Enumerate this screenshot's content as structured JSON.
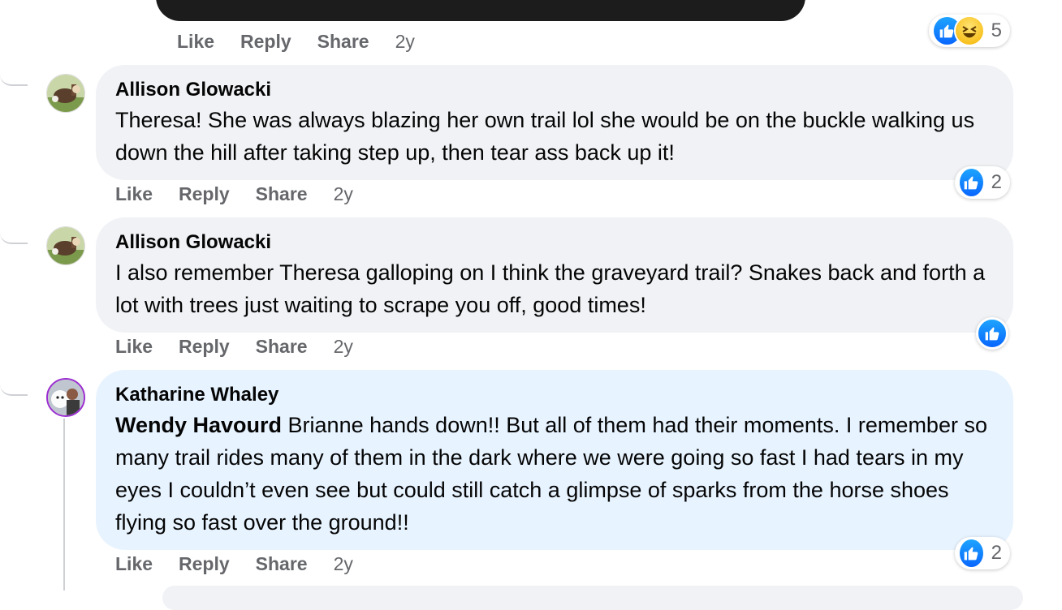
{
  "top_post": {
    "actions": {
      "like": "Like",
      "reply": "Reply",
      "share": "Share"
    },
    "time": "2y",
    "reactions": {
      "icons": [
        "like-icon",
        "haha-icon"
      ],
      "count": "5"
    }
  },
  "comments": [
    {
      "author": "Allison Glowacki",
      "mention": "",
      "text": "Theresa! She was always blazing her own trail lol she would be on the buckle walking us down the hill after taking step up, then tear ass back up it!",
      "actions": {
        "like": "Like",
        "reply": "Reply",
        "share": "Share"
      },
      "time": "2y",
      "reactions": {
        "icons": [
          "like-icon"
        ],
        "count": "2"
      }
    },
    {
      "author": "Allison Glowacki",
      "mention": "",
      "text": "I also remember Theresa galloping on I think the graveyard trail? Snakes back and forth a lot with trees just waiting to scrape you off, good times!",
      "actions": {
        "like": "Like",
        "reply": "Reply",
        "share": "Share"
      },
      "time": "2y",
      "reactions": {
        "icons": [
          "like-icon"
        ],
        "count": ""
      }
    },
    {
      "author": "Katharine Whaley",
      "mention": "Wendy Havourd",
      "text": "Brianne hands down!! But all of them had their moments. I remember so many trail rides many of them in the dark where we were going so fast I had tears in my eyes I couldn’t even see but could still catch a glimpse of sparks from the horse shoes flying so fast over the ground!!",
      "actions": {
        "like": "Like",
        "reply": "Reply",
        "share": "Share"
      },
      "time": "2y",
      "reactions": {
        "icons": [
          "like-icon"
        ],
        "count": "2"
      }
    }
  ],
  "colors": {
    "bubble": "#f0f2f5",
    "bubble_highlight": "#e7f3ff",
    "action_text": "#65676b",
    "like_blue": "#0866ff"
  }
}
